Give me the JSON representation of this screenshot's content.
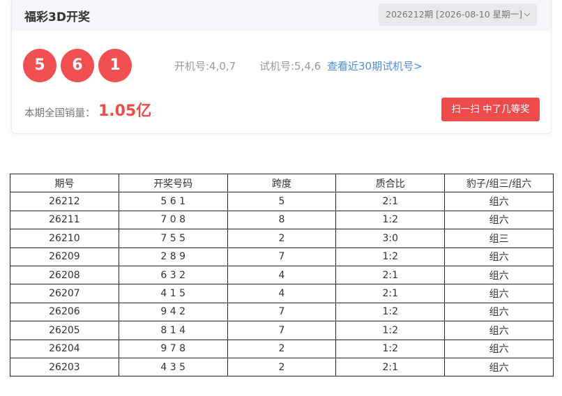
{
  "header": {
    "title": "福彩3D开奖",
    "issue_select_value": "2026212期 [2026-08-10 星期一]",
    "chevron_icon": "chevron-down-icon"
  },
  "draw": {
    "balls": [
      "5",
      "6",
      "1"
    ],
    "kaiji": "开机号:4,0,7",
    "shiji": "试机号:5,4,6",
    "recent_link": "查看近30期试机号>",
    "sales_label": "本期全国销量：",
    "sales_value": "1.05亿",
    "scan_button": "扫一扫 中了几等奖"
  },
  "colors": {
    "ball": "#f05052",
    "accent_red": "#f04b4b",
    "link_blue": "#4a8fe7"
  },
  "table": {
    "headers": [
      "期号",
      "开奖号码",
      "跨度",
      "质合比",
      "豹子/组三/组六"
    ],
    "rows": [
      [
        "26212",
        "5 6 1",
        "5",
        "2:1",
        "组六"
      ],
      [
        "26211",
        "7 0 8",
        "8",
        "1:2",
        "组六"
      ],
      [
        "26210",
        "7 5 5",
        "2",
        "3:0",
        "组三"
      ],
      [
        "26209",
        "2 8 9",
        "7",
        "1:2",
        "组六"
      ],
      [
        "26208",
        "6 3 2",
        "4",
        "2:1",
        "组六"
      ],
      [
        "26207",
        "4 1 5",
        "4",
        "2:1",
        "组六"
      ],
      [
        "26206",
        "9 4 2",
        "7",
        "1:2",
        "组六"
      ],
      [
        "26205",
        "8 1 4",
        "7",
        "1:2",
        "组六"
      ],
      [
        "26204",
        "9 7 8",
        "2",
        "1:2",
        "组六"
      ],
      [
        "26203",
        "4 3 5",
        "2",
        "2:1",
        "组六"
      ]
    ]
  }
}
